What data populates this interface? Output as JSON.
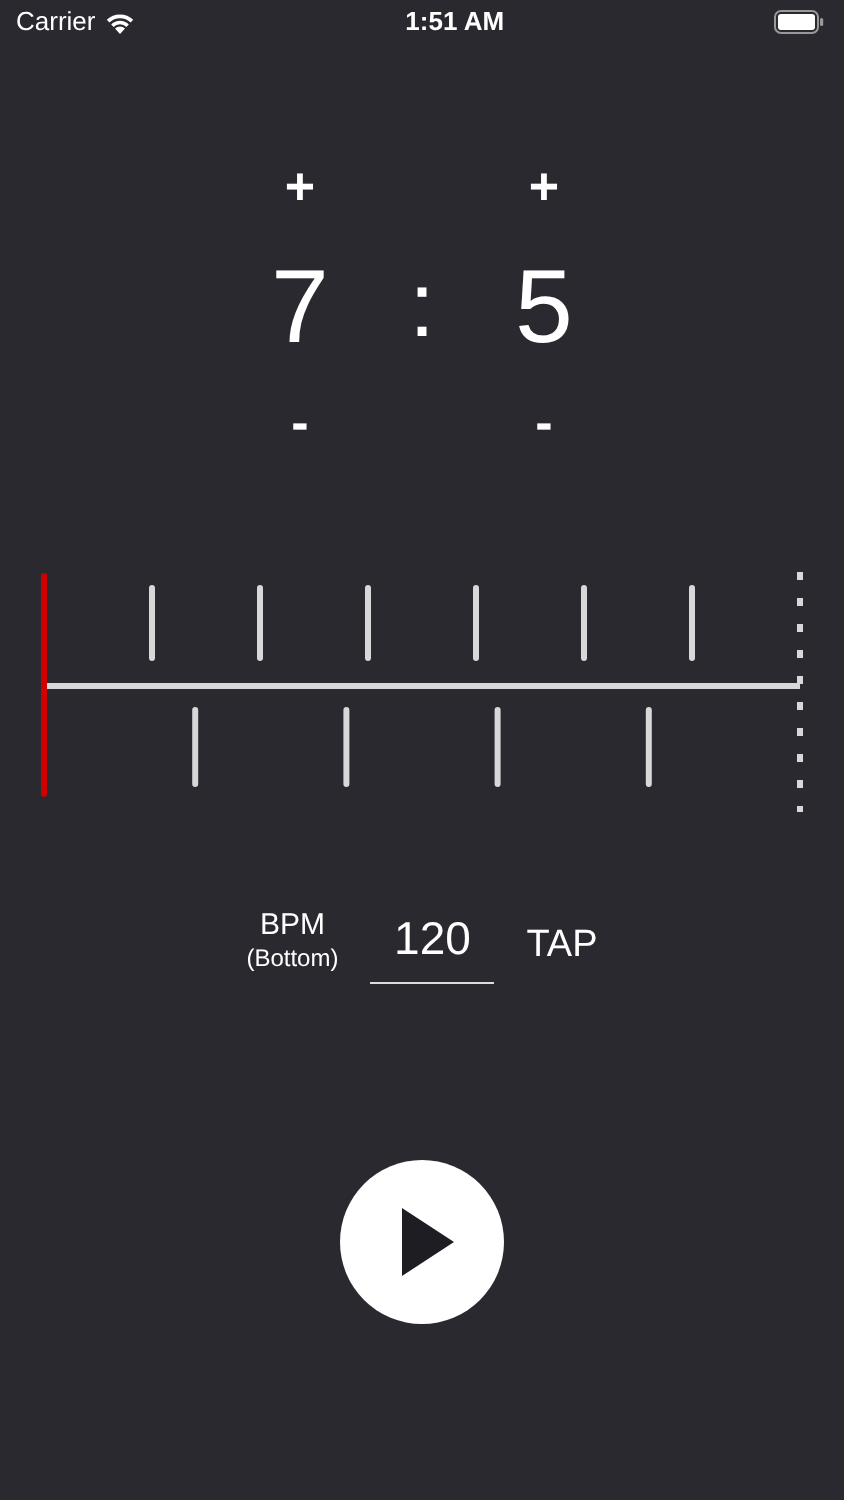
{
  "status_bar": {
    "carrier": "Carrier",
    "time": "1:51 AM"
  },
  "ratio": {
    "top": {
      "increment": "+",
      "value": "7",
      "decrement": "-"
    },
    "separator": ":",
    "bottom": {
      "increment": "+",
      "value": "5",
      "decrement": "-"
    }
  },
  "tempo": {
    "label": "BPM",
    "sublabel": "(Bottom)",
    "value": "120",
    "tap": "TAP"
  }
}
